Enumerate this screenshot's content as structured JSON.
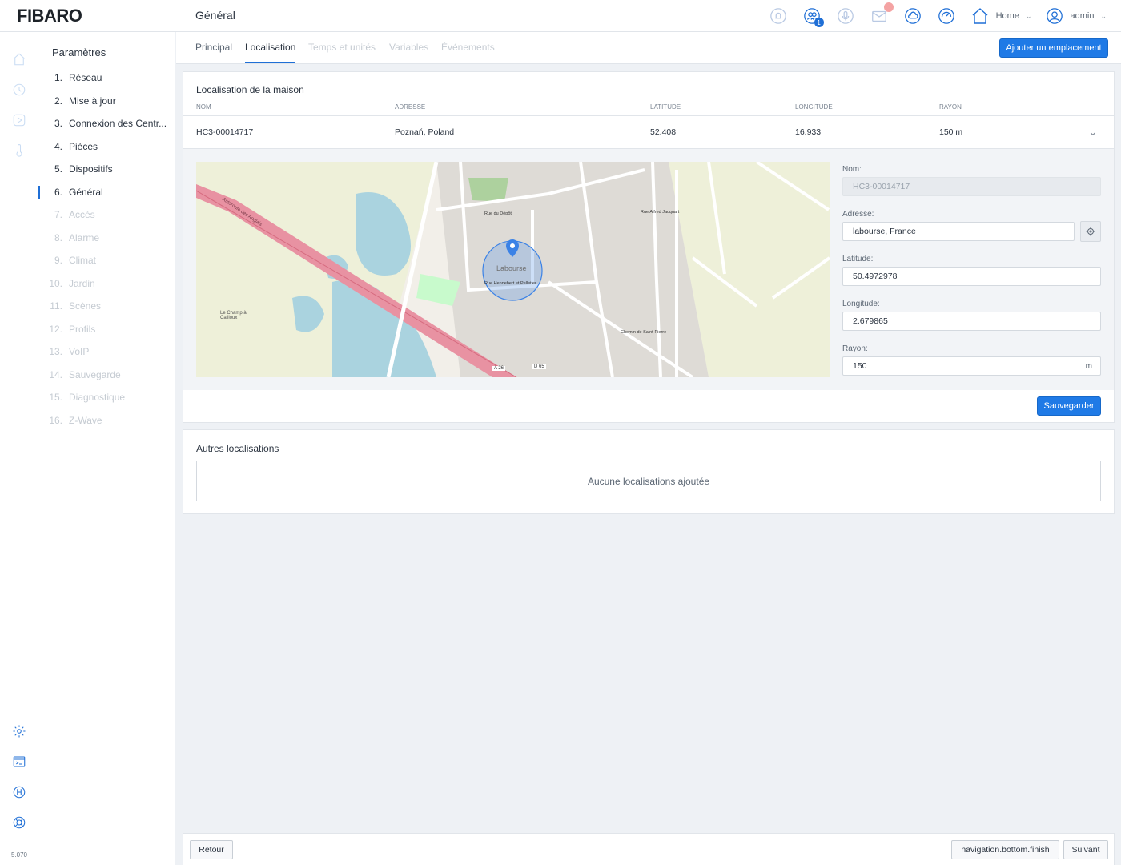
{
  "app": {
    "logo": "FIBARO",
    "page_title": "Général",
    "version": "5.070"
  },
  "topbar": {
    "notification_badge": "1",
    "home_label": "Home",
    "user_label": "admin",
    "accent_color": "#1f6fd6"
  },
  "rail_icons": [
    "home-icon",
    "devices-icon",
    "scenes-icon",
    "thermometer-icon",
    "settings-gear-icon",
    "terminal-icon",
    "plugin-icon",
    "help-lifebuoy-icon"
  ],
  "settings_nav": {
    "title": "Paramètres",
    "items": [
      {
        "num": "1.",
        "label": "Réseau",
        "state": "enabled"
      },
      {
        "num": "2.",
        "label": "Mise à jour",
        "state": "enabled"
      },
      {
        "num": "3.",
        "label": "Connexion des Centr...",
        "state": "enabled"
      },
      {
        "num": "4.",
        "label": "Pièces",
        "state": "enabled"
      },
      {
        "num": "5.",
        "label": "Dispositifs",
        "state": "enabled"
      },
      {
        "num": "6.",
        "label": "Général",
        "state": "active"
      },
      {
        "num": "7.",
        "label": "Accès",
        "state": "disabled"
      },
      {
        "num": "8.",
        "label": "Alarme",
        "state": "disabled"
      },
      {
        "num": "9.",
        "label": "Climat",
        "state": "disabled"
      },
      {
        "num": "10.",
        "label": "Jardin",
        "state": "disabled"
      },
      {
        "num": "11.",
        "label": "Scènes",
        "state": "disabled"
      },
      {
        "num": "12.",
        "label": "Profils",
        "state": "disabled"
      },
      {
        "num": "13.",
        "label": "VoIP",
        "state": "disabled"
      },
      {
        "num": "14.",
        "label": "Sauvegarde",
        "state": "disabled"
      },
      {
        "num": "15.",
        "label": "Diagnostique",
        "state": "disabled"
      },
      {
        "num": "16.",
        "label": "Z-Wave",
        "state": "disabled"
      }
    ]
  },
  "tabs": [
    {
      "label": "Principal",
      "state": "enabled"
    },
    {
      "label": "Localisation",
      "state": "active"
    },
    {
      "label": "Temps et unités",
      "state": "disabled"
    },
    {
      "label": "Variables",
      "state": "disabled"
    },
    {
      "label": "Événements",
      "state": "disabled"
    }
  ],
  "add_location_button": "Ajouter un emplacement",
  "home_location": {
    "title": "Localisation de la maison",
    "columns": [
      "Nom",
      "Adresse",
      "Latitude",
      "Longitude",
      "Rayon"
    ],
    "row": {
      "name": "HC3-00014717",
      "address": "Poznań, Poland",
      "latitude": "52.408",
      "longitude": "16.933",
      "radius": "150 m"
    }
  },
  "map": {
    "center_label": "Labourse",
    "street_labels": [
      "Autoroute des Anglais",
      "Le Champ à Cailloux",
      "Rue Hennebert et Pelletier",
      "Rue Alfred Jacquart",
      "Rue du Dépôt",
      "Chemin de Saint-Pierre",
      "A 26",
      "D 65"
    ]
  },
  "form": {
    "name_label": "Nom:",
    "name_value": "HC3-00014717",
    "address_label": "Adresse:",
    "address_value": "labourse, France",
    "latitude_label": "Latitude:",
    "latitude_value": "50.4972978",
    "longitude_label": "Longitude:",
    "longitude_value": "2.679865",
    "radius_label": "Rayon:",
    "radius_value": "150",
    "radius_unit": "m",
    "save_button": "Sauvegarder"
  },
  "other_locations": {
    "title": "Autres localisations",
    "empty_text": "Aucune localisations ajoutée"
  },
  "bottom": {
    "back_button": "Retour",
    "finish_button": "navigation.bottom.finish",
    "next_button": "Suivant"
  }
}
